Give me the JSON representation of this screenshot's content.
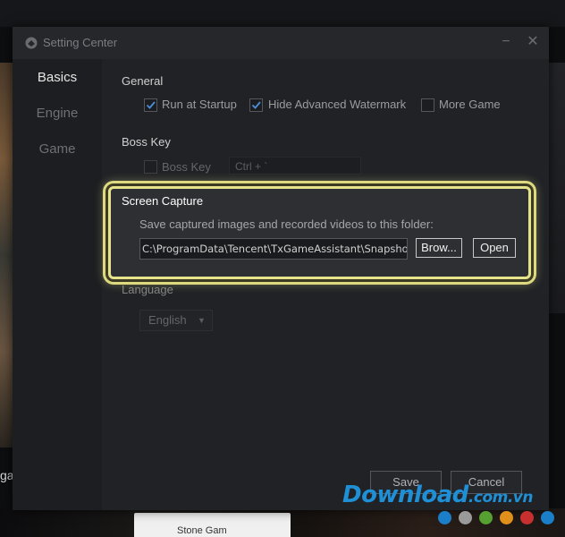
{
  "window": {
    "title": "Setting Center",
    "minimize_glyph": "−",
    "close_glyph": "✕"
  },
  "sidebar": {
    "items": [
      {
        "label": "Basics",
        "active": true
      },
      {
        "label": "Engine",
        "active": false
      },
      {
        "label": "Game",
        "active": false
      }
    ]
  },
  "general": {
    "title": "General",
    "options": [
      {
        "label": "Run at Startup",
        "checked": true
      },
      {
        "label": "Hide Advanced Watermark",
        "checked": true
      },
      {
        "label": "More Game",
        "checked": false
      }
    ]
  },
  "boss_key": {
    "title": "Boss Key",
    "checkbox_label": "Boss Key",
    "checked": false,
    "hotkey": "Ctrl + `"
  },
  "screen_capture": {
    "title": "Screen Capture",
    "description": "Save captured images and recorded videos to this folder:",
    "path": "C:\\ProgramData\\Tencent\\TxGameAssistant\\Snapshot",
    "browse_label": "Brow...",
    "open_label": "Open",
    "highlight_color": "#e6e38a"
  },
  "language": {
    "title": "Language",
    "selected": "English",
    "caret": "▼"
  },
  "footer": {
    "save_label": "Save",
    "cancel_label": "Cancel"
  },
  "background": {
    "left_text": "ga",
    "bottom_text": "Stone Gam"
  },
  "watermark": {
    "main": "Download",
    "suffix": ".com.vn",
    "dot_colors": [
      "#1a7fc8",
      "#9a9a9a",
      "#55a030",
      "#e0901a",
      "#c83030",
      "#1a7fc8"
    ]
  }
}
